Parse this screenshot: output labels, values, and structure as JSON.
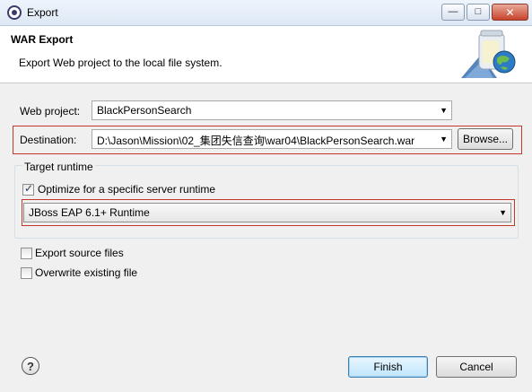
{
  "window": {
    "title": "Export",
    "icon": "eclipse-icon"
  },
  "banner": {
    "title": "WAR Export",
    "description": "Export Web project to the local file system."
  },
  "form": {
    "web_project_label": "Web project:",
    "web_project_value": "BlackPersonSearch",
    "destination_label": "Destination:",
    "destination_value": "D:\\Jason\\Mission\\02_集团失信查询\\war04\\BlackPersonSearch.war",
    "browse_label": "Browse...",
    "target_runtime_group": "Target runtime",
    "optimize_label": "Optimize for a specific server runtime",
    "optimize_checked": true,
    "runtime_value": "JBoss EAP 6.1+ Runtime",
    "export_source_label": "Export source files",
    "export_source_checked": false,
    "overwrite_label": "Overwrite existing file",
    "overwrite_checked": false
  },
  "footer": {
    "finish_label": "Finish",
    "cancel_label": "Cancel"
  },
  "colors": {
    "highlight_border": "#c0392b",
    "background": "#f0f0f0"
  }
}
